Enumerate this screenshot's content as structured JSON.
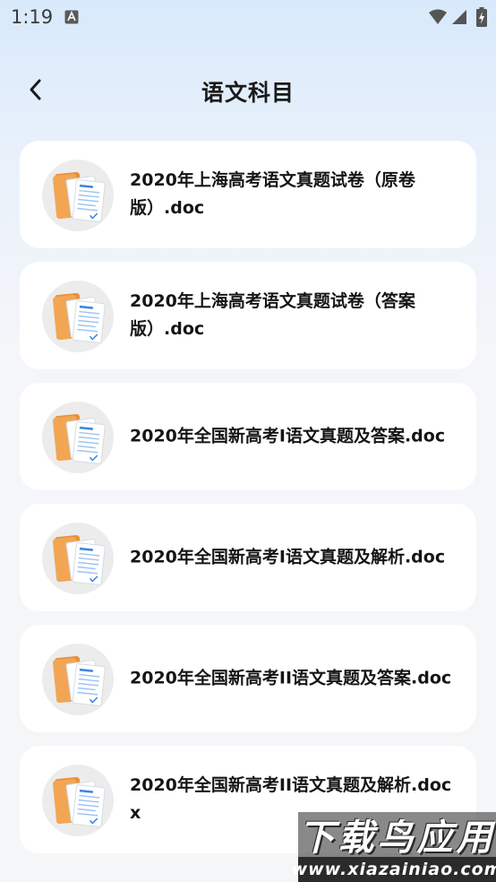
{
  "status_bar": {
    "time": "1:19",
    "icons": [
      "a-notification-icon",
      "wifi-icon",
      "signal-icon",
      "battery-charging-icon"
    ]
  },
  "header": {
    "title": "语文科目",
    "back_icon": "chevron-left-icon"
  },
  "files": [
    {
      "name": "2020年上海高考语文真题试卷（原卷版）.doc",
      "icon": "document-folder-icon"
    },
    {
      "name": "2020年上海高考语文真题试卷（答案版）.doc",
      "icon": "document-folder-icon"
    },
    {
      "name": "2020年全国新高考I语文真题及答案.doc",
      "icon": "document-folder-icon"
    },
    {
      "name": "2020年全国新高考I语文真题及解析.doc",
      "icon": "document-folder-icon"
    },
    {
      "name": "2020年全国新高考II语文真题及答案.doc",
      "icon": "document-folder-icon"
    },
    {
      "name": "2020年全国新高考II语文真题及解析.docx",
      "icon": "document-folder-icon"
    }
  ],
  "watermark": {
    "title": "下载鸟应用",
    "url": "www.xiazainiao.com"
  },
  "colors": {
    "card_background": "#ffffff",
    "folder_orange": "#f2a654",
    "paper_blue": "#4a90d9",
    "icon_circle": "#ececec"
  }
}
